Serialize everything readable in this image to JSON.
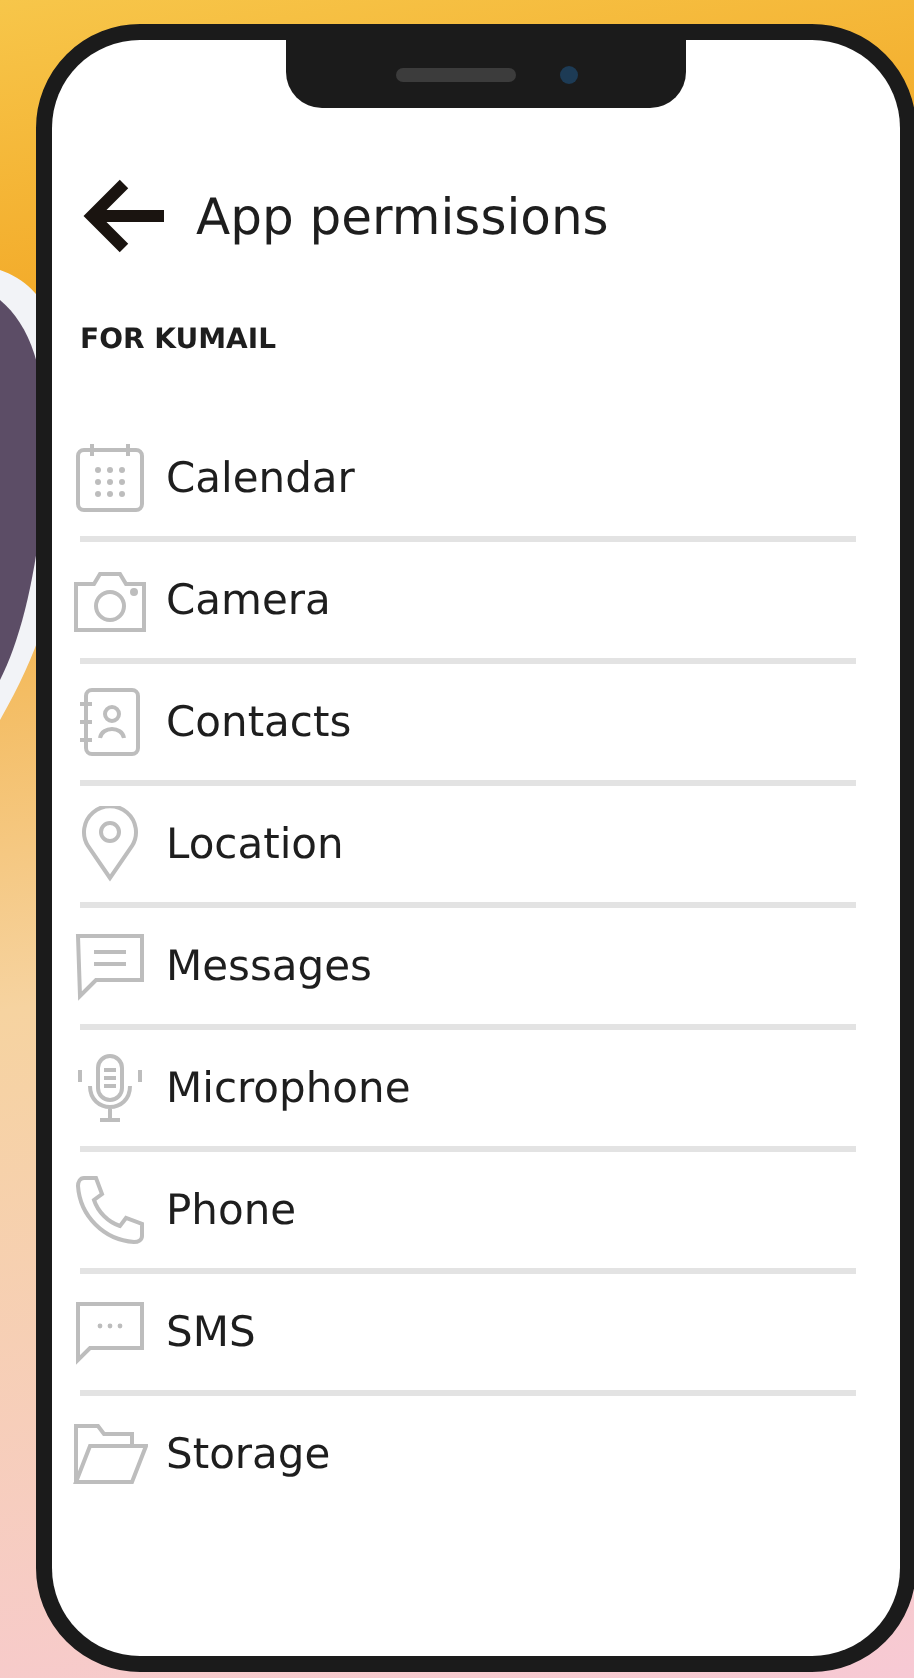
{
  "header": {
    "title": "App permissions"
  },
  "section": {
    "label": "FOR KUMAIL"
  },
  "permissions": [
    {
      "kind": "calendar",
      "label": "Calendar"
    },
    {
      "kind": "camera",
      "label": "Camera"
    },
    {
      "kind": "contacts",
      "label": "Contacts"
    },
    {
      "kind": "location",
      "label": "Location"
    },
    {
      "kind": "messages",
      "label": "Messages"
    },
    {
      "kind": "microphone",
      "label": "Microphone"
    },
    {
      "kind": "phone",
      "label": "Phone"
    },
    {
      "kind": "sms",
      "label": "SMS"
    },
    {
      "kind": "storage",
      "label": "Storage"
    }
  ]
}
